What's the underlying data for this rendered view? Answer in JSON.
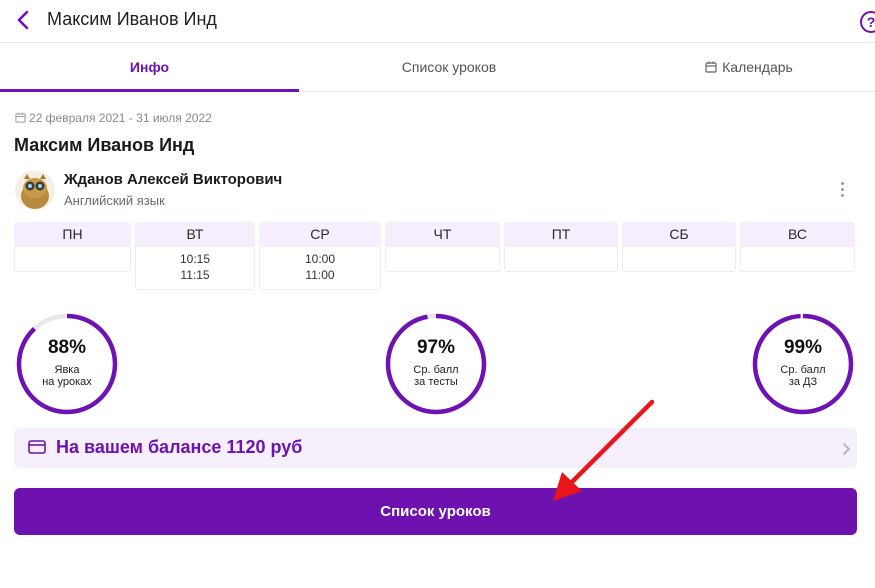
{
  "header": {
    "title": "Максим Иванов Инд",
    "help_label": "?"
  },
  "tabs": [
    {
      "label": "Инфо",
      "active": true
    },
    {
      "label": "Список уроков",
      "active": false
    },
    {
      "label": "Календарь",
      "active": false
    }
  ],
  "course": {
    "date_range": "22 февраля 2021 - 31 июля 2022",
    "student_name": "Максим Иванов Инд"
  },
  "teacher": {
    "name": "Жданов Алексей Викторович",
    "subject": "Английский язык"
  },
  "schedule": [
    {
      "day": "ПН",
      "times": []
    },
    {
      "day": "ВТ",
      "times": [
        "10:15",
        "11:15"
      ]
    },
    {
      "day": "СР",
      "times": [
        "10:00",
        "11:00"
      ]
    },
    {
      "day": "ЧТ",
      "times": []
    },
    {
      "day": "ПТ",
      "times": []
    },
    {
      "day": "СБ",
      "times": []
    },
    {
      "day": "ВС",
      "times": []
    }
  ],
  "stats": [
    {
      "value": "88%",
      "percent": 88,
      "label_line1": "Явка",
      "label_line2": "на уроках"
    },
    {
      "value": "97%",
      "percent": 97,
      "label_line1": "Ср. балл",
      "label_line2": "за тесты"
    },
    {
      "value": "99%",
      "percent": 99,
      "label_line1": "Ср. балл",
      "label_line2": "за ДЗ"
    }
  ],
  "balance": {
    "text": "На вашем балансе 1120 руб"
  },
  "primary_button": {
    "label": "Список уроков"
  },
  "colors": {
    "accent": "#6e12b3",
    "ring_track": "#e8e8e8",
    "annotation_arrow": "#e8161b"
  }
}
